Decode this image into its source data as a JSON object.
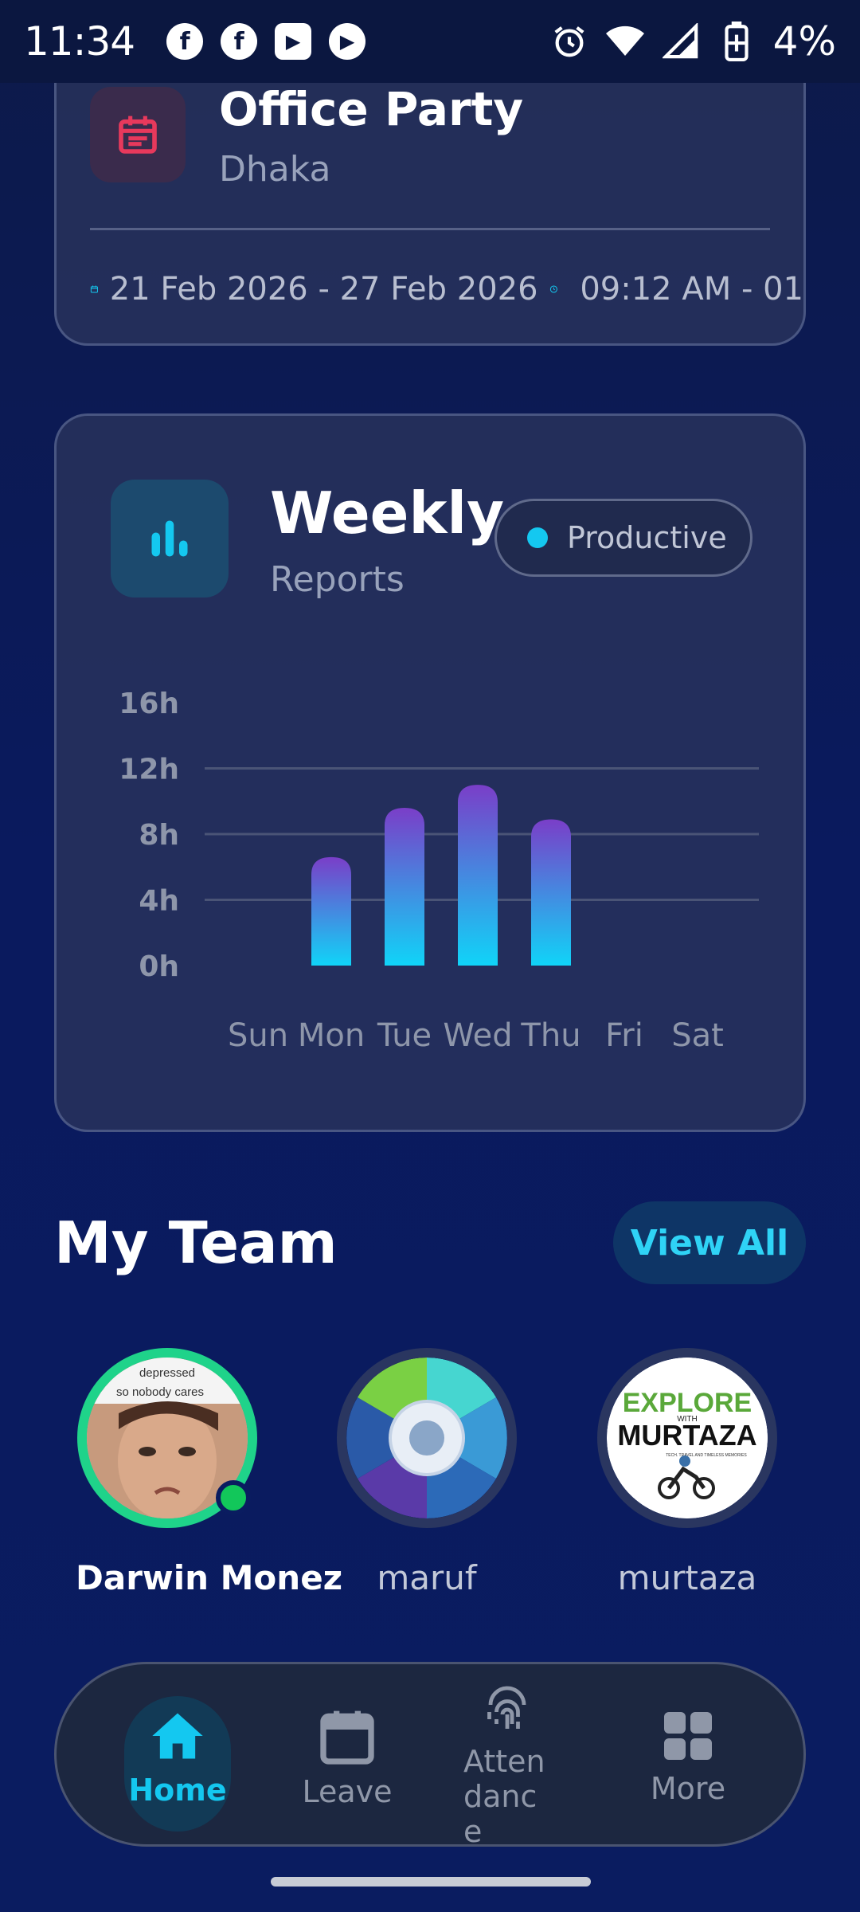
{
  "status_bar": {
    "time": "11:34",
    "battery": "4%",
    "app_icons": [
      "facebook-icon",
      "facebook-icon",
      "app-icon",
      "play-icon"
    ]
  },
  "event": {
    "title": "Office Party",
    "location": "Dhaka",
    "date_range": "21 Feb 2026 - 27 Feb 2026",
    "time_range": "09:12 AM - 01"
  },
  "report": {
    "title": "Weekly",
    "subtitle": "Reports",
    "legend_label": "Productive"
  },
  "chart_data": {
    "type": "bar",
    "categories": [
      "Sun",
      "Mon",
      "Tue",
      "Wed",
      "Thu",
      "Fri",
      "Sat"
    ],
    "values": [
      0,
      6.6,
      9.6,
      11,
      8.9,
      0,
      0
    ],
    "series": [
      {
        "name": "Productive",
        "values": [
          0,
          6.6,
          9.6,
          11,
          8.9,
          0,
          0
        ]
      }
    ],
    "ytick_labels": [
      "0h",
      "4h",
      "8h",
      "12h",
      "16h"
    ],
    "ylim": [
      0,
      16
    ],
    "grid": true,
    "colors": {
      "bar_top": "#7a3ec8",
      "bar_bottom": "#10d4f8",
      "grid": "#4a5476",
      "tick": "#8e96aa"
    }
  },
  "team": {
    "title": "My Team",
    "view_all_label": "View All",
    "members": [
      {
        "name": "Darwin Monez",
        "online": true
      },
      {
        "name": "maruf",
        "online": false
      },
      {
        "name": "murtaza",
        "online": false
      }
    ],
    "avatar_texts": {
      "darwin_caption_1": "depressed",
      "darwin_caption_2": "so nobody cares",
      "murtaza_line_1": "EXPLORE",
      "murtaza_with": "WITH",
      "murtaza_line_2": "MURTAZA",
      "murtaza_tagline": "TECH. TRAVEL AND TIMELESS MEMORIES"
    }
  },
  "nav": {
    "items": [
      {
        "label": "Home",
        "icon": "home-icon",
        "active": true
      },
      {
        "label": "Leave",
        "icon": "calendar-icon",
        "active": false
      },
      {
        "label": "Attendanc e",
        "icon": "fingerprint-icon",
        "active": false
      },
      {
        "label": "More",
        "icon": "grid-icon",
        "active": false
      }
    ]
  },
  "colors": {
    "accent": "#14c8f0",
    "online": "#12c75a",
    "event_icon": "#e8395c"
  }
}
